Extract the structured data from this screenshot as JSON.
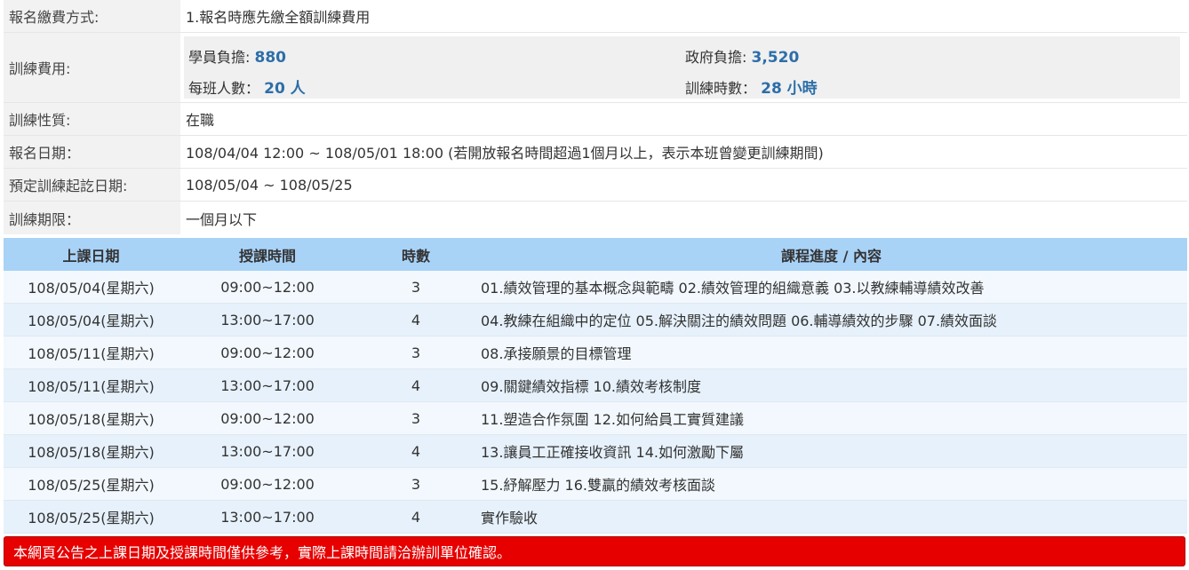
{
  "info": {
    "payment": {
      "label": "報名繳費方式:",
      "value": "1.報名時應先繳全額訓練費用"
    },
    "fee": {
      "label": "訓練費用:",
      "student_label": "學員負擔:",
      "student_value": "880",
      "gov_label": "政府負擔:",
      "gov_value": "3,520",
      "class_size_label": "每班人數：",
      "class_size_value": "20 人",
      "hours_label": "訓練時數：",
      "hours_value": "28 小時"
    },
    "nature": {
      "label": "訓練性質:",
      "value": "在職"
    },
    "reg_date": {
      "label": "報名日期：",
      "value": "108/04/04 12:00 ~ 108/05/01 18:00 (若開放報名時間超過1個月以上，表示本班曾變更訓練期間)"
    },
    "period": {
      "label": "預定訓練起訖日期:",
      "value": "108/05/04 ~ 108/05/25"
    },
    "duration": {
      "label": "訓練期限：",
      "value": "一個月以下"
    }
  },
  "schedule": {
    "headers": [
      "上課日期",
      "授課時間",
      "時數",
      "課程進度 / 內容"
    ],
    "rows": [
      [
        "108/05/04(星期六)",
        "09:00~12:00",
        "3",
        "01.績效管理的基本概念與範疇 02.績效管理的組織意義 03.以教練輔導績效改善"
      ],
      [
        "108/05/04(星期六)",
        "13:00~17:00",
        "4",
        "04.教練在組織中的定位 05.解決關注的績效問題 06.輔導績效的步驟 07.績效面談"
      ],
      [
        "108/05/11(星期六)",
        "09:00~12:00",
        "3",
        "08.承接願景的目標管理"
      ],
      [
        "108/05/11(星期六)",
        "13:00~17:00",
        "4",
        "09.關鍵績效指標 10.績效考核制度"
      ],
      [
        "108/05/18(星期六)",
        "09:00~12:00",
        "3",
        "11.塑造合作氛圍 12.如何給員工實質建議"
      ],
      [
        "108/05/18(星期六)",
        "13:00~17:00",
        "4",
        "13.讓員工正確接收資訊 14.如何激勵下屬"
      ],
      [
        "108/05/25(星期六)",
        "09:00~12:00",
        "3",
        "15.紓解壓力 16.雙贏的績效考核面談"
      ],
      [
        "108/05/25(星期六)",
        "13:00~17:00",
        "4",
        "實作驗收"
      ]
    ]
  },
  "notice": "本網頁公告之上課日期及授課時間僅供參考，實際上課時間請洽辦訓單位確認。",
  "colors": {
    "header_bg": "#a9d2f7",
    "accent_number": "#2d6ea8",
    "notice_bg": "#e60000"
  }
}
